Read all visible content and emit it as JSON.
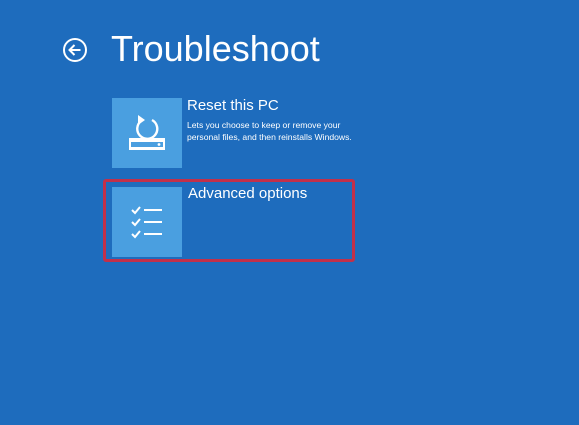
{
  "header": {
    "title": "Troubleshoot",
    "back_icon": "back-arrow-icon"
  },
  "options": [
    {
      "title": "Reset this PC",
      "description": "Lets you choose to keep or remove your personal files, and then reinstalls Windows.",
      "icon": "reset-pc-icon"
    },
    {
      "title": "Advanced options",
      "description": "",
      "icon": "checklist-icon"
    }
  ],
  "colors": {
    "background": "#1e6cbd",
    "tile": "#4a9fe0",
    "highlight": "#c2304a",
    "text": "#ffffff"
  }
}
